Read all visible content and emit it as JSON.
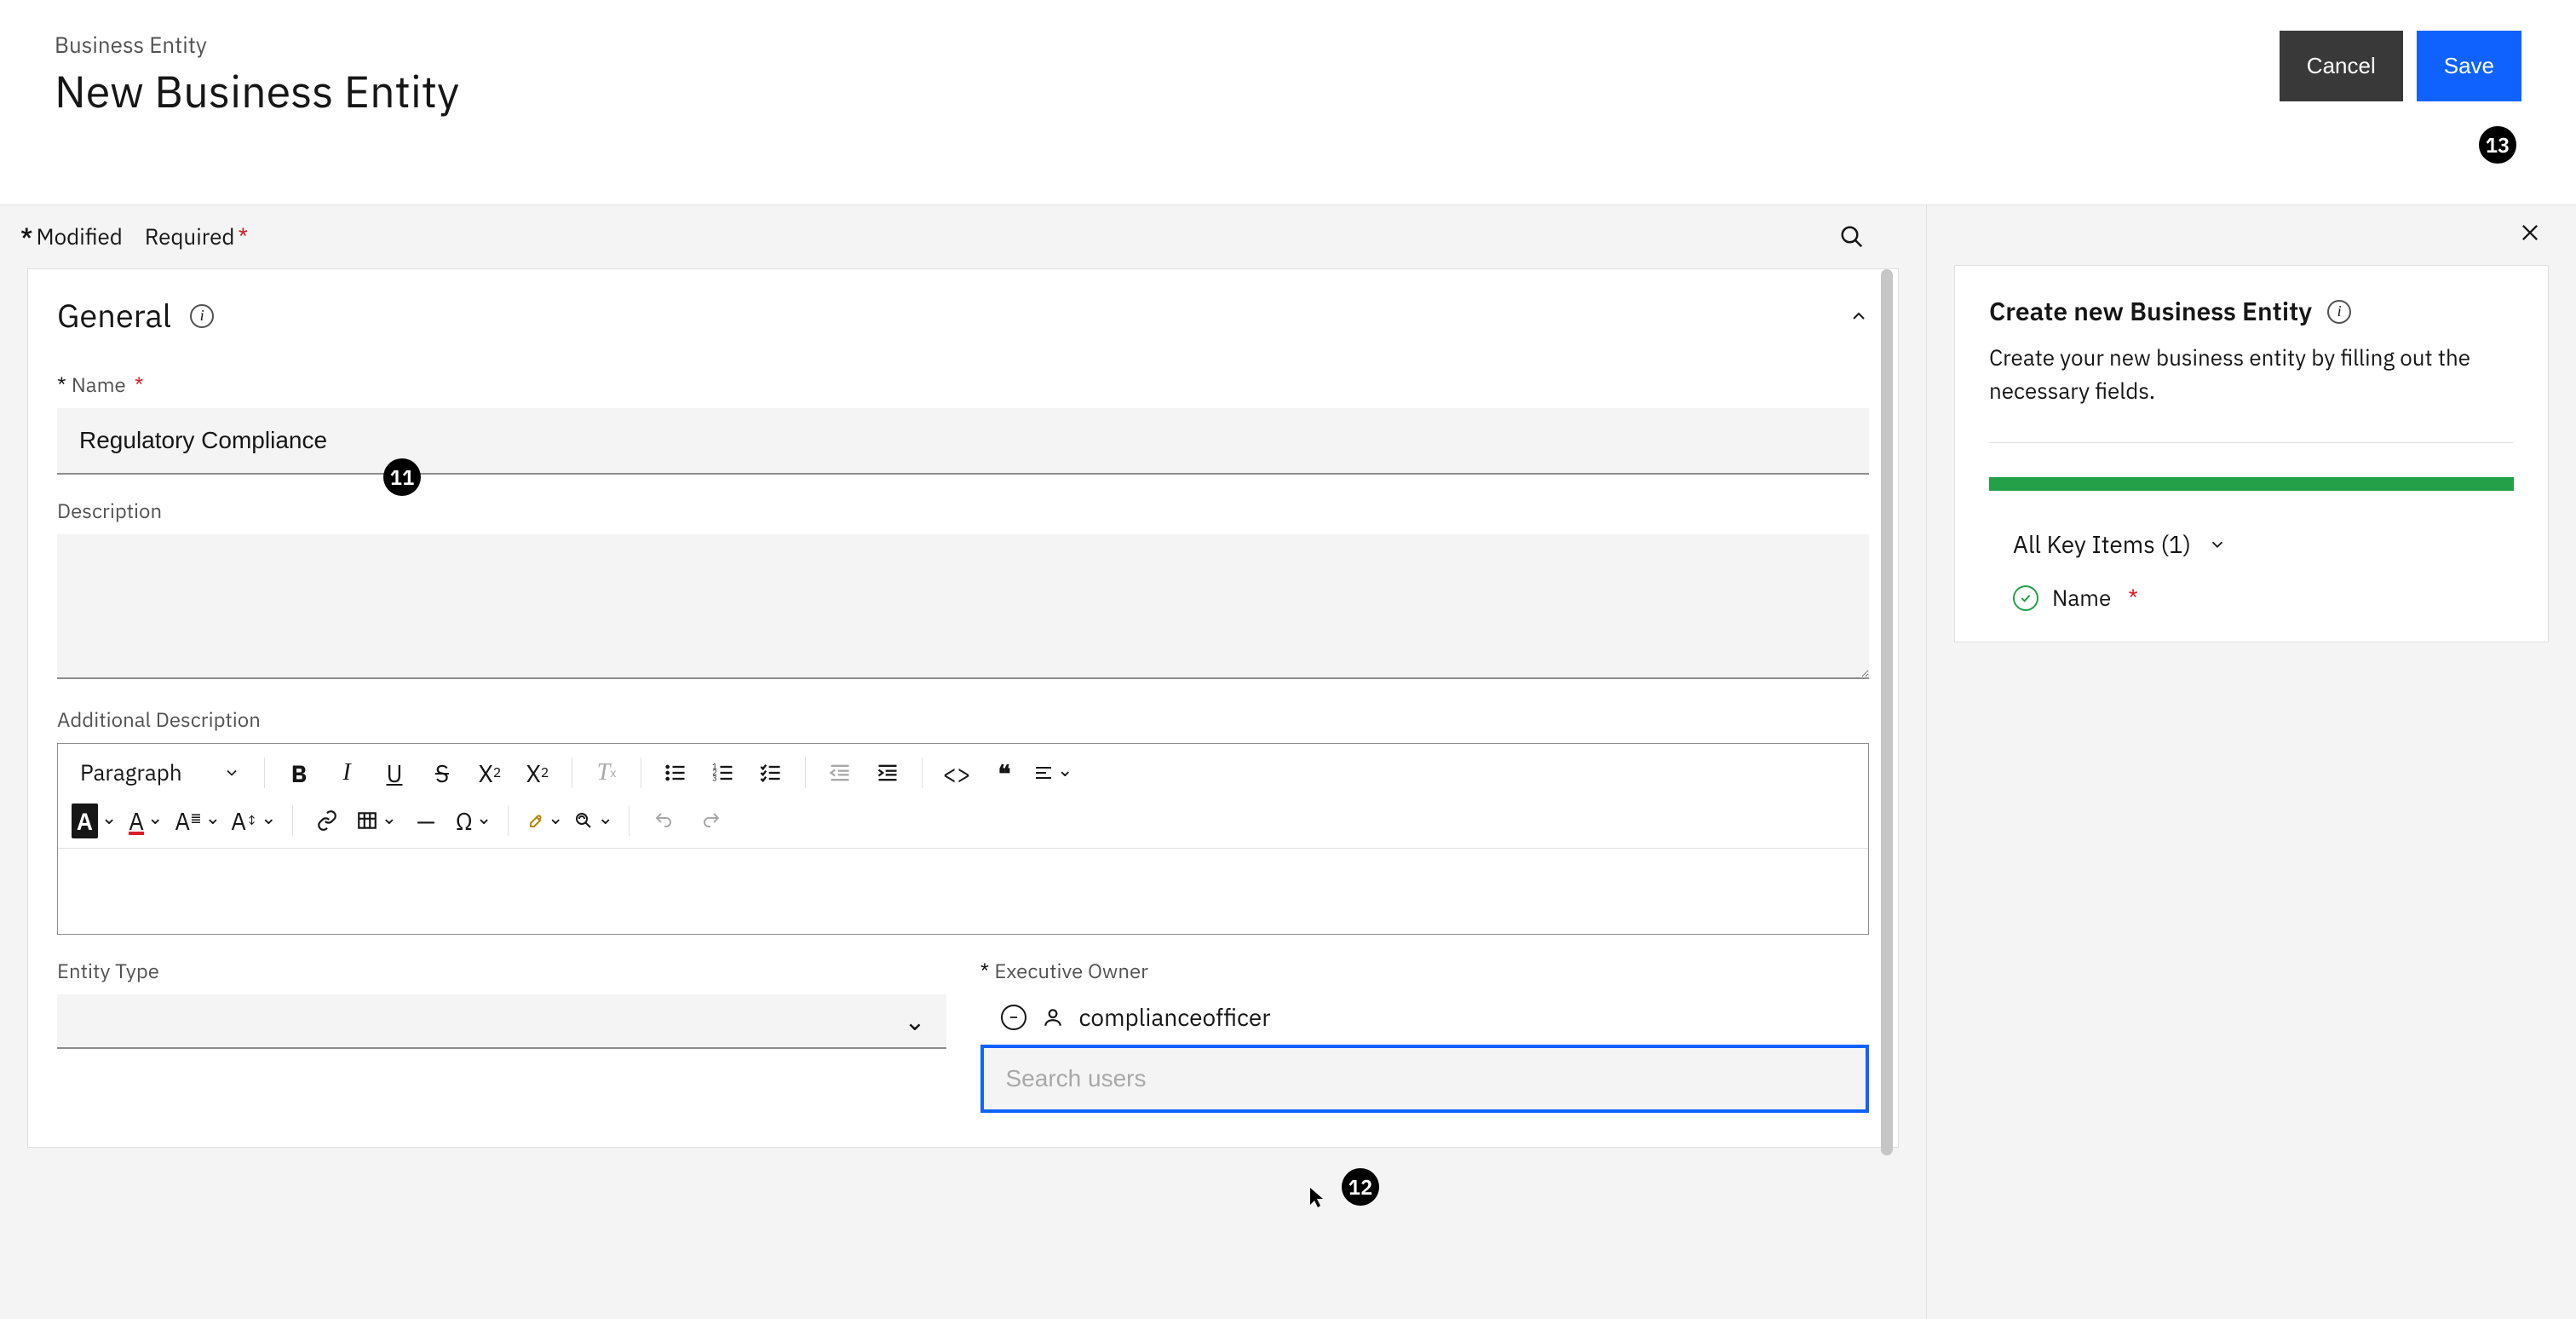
{
  "header": {
    "breadcrumb": "Business Entity",
    "title": "New Business Entity",
    "cancel_label": "Cancel",
    "save_label": "Save"
  },
  "legend": {
    "modified_label": "Modified",
    "required_label": "Required"
  },
  "general": {
    "title": "General",
    "name_label": "Name",
    "name_value": "Regulatory Compliance",
    "description_label": "Description",
    "additional_description_label": "Additional Description"
  },
  "rte": {
    "paragraph_label": "Paragraph"
  },
  "entity": {
    "type_label": "Entity Type",
    "owner_label": "Executive Owner",
    "owner_value": "complianceofficer",
    "search_placeholder": "Search users"
  },
  "side": {
    "title": "Create new Business Entity",
    "description": "Create your new business entity by filling out the necessary fields.",
    "key_items_label": "All Key Items (1)",
    "name_item_label": "Name"
  },
  "annotations": {
    "b11": "11",
    "b12": "12",
    "b13": "13"
  }
}
